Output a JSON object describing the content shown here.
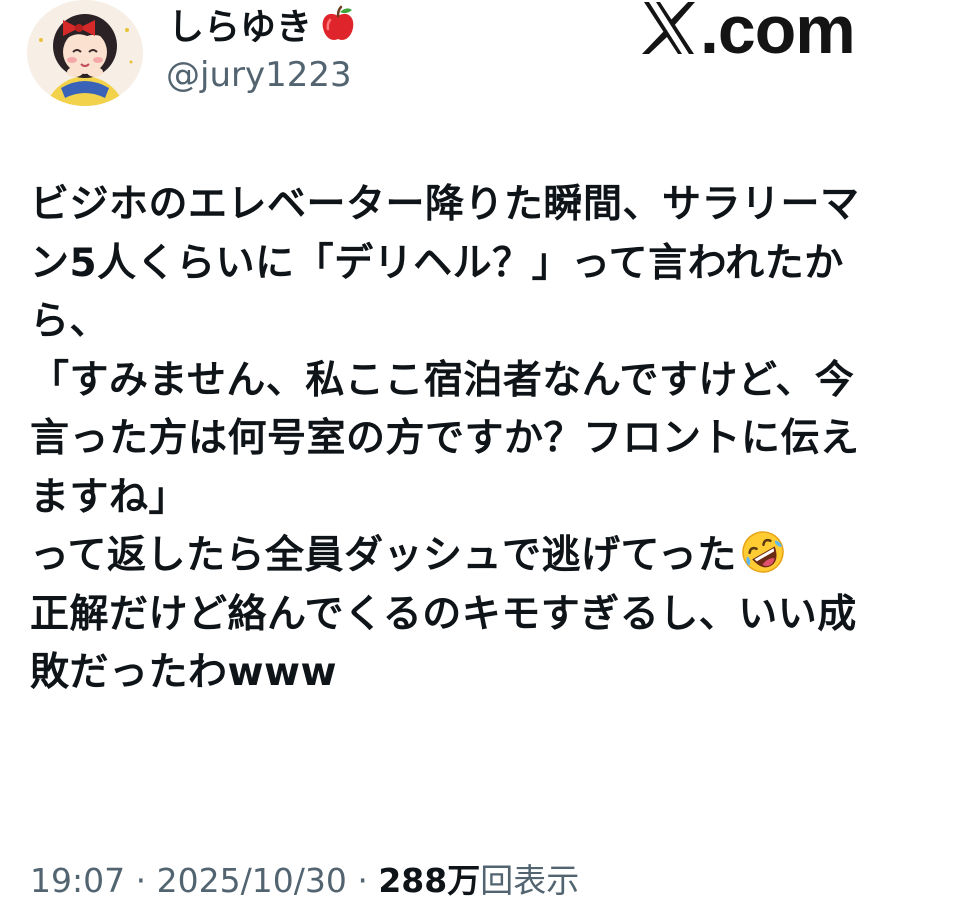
{
  "post": {
    "author": {
      "display_name": "しらゆき",
      "name_emoji": "red-apple-icon",
      "handle": "@jury1223"
    },
    "brand": {
      "logo": "x-logo-icon",
      "text": ".com"
    },
    "body_lines": [
      "ビジホのエレベーター降りた瞬間、サラリーマ",
      "ン5人くらいに「デリヘル？」って言われたか",
      "ら、",
      "「すみません、私ここ宿泊者なんですけど、今",
      "言った方は何号室の方ですか？フロントに伝え",
      "ますね」",
      "って返したら全員ダッシュで逃げてった",
      "正解だけど絡んでくるのキモすぎるし、いい成",
      "敗だったわwww"
    ],
    "inline_emoji": "rolling-on-floor-laughing-icon",
    "meta": {
      "time": "19:07",
      "separator": "·",
      "date": "2025/10/30",
      "views_count": "288万",
      "views_label": "回表示"
    }
  },
  "colors": {
    "text": "#0f1419",
    "secondary": "#536471",
    "background": "#ffffff"
  }
}
